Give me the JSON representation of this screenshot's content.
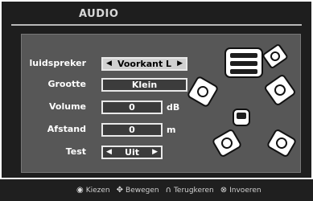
{
  "title": "AUDIO",
  "rows": [
    {
      "label": "luidspreker",
      "value": "Voorkant L",
      "unit": ""
    },
    {
      "label": "Grootte",
      "value": "Klein",
      "unit": ""
    },
    {
      "label": "Volume",
      "value": "0",
      "unit": "dB"
    },
    {
      "label": "Afstand",
      "value": "0",
      "unit": "m"
    },
    {
      "label": "Test",
      "value": "Uit",
      "unit": ""
    }
  ],
  "footer": {
    "select": "Kiezen",
    "move": "Bewegen",
    "back": "Terugkeren",
    "enter": "Invoeren"
  },
  "icons": [
    "select-icon",
    "move-icon",
    "back-icon",
    "enter-icon",
    "speaker-icon",
    "listener-icon"
  ]
}
